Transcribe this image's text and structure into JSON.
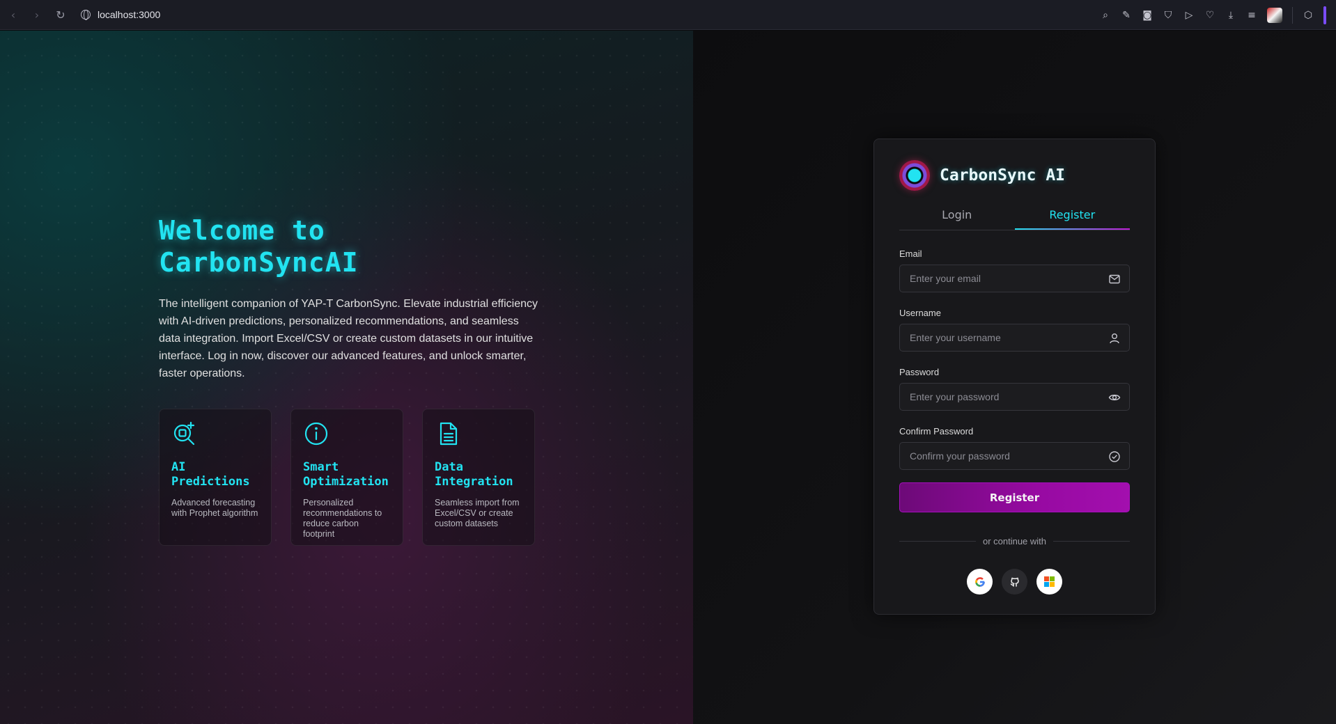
{
  "browser": {
    "url": "localhost:3000",
    "nav_icons": [
      "back-icon",
      "forward-icon",
      "reload-icon"
    ],
    "tool_icons": [
      "zoom-icon",
      "edit-icon",
      "camera-icon",
      "shield-icon",
      "send-icon",
      "heart-icon",
      "download-icon",
      "menu-icon"
    ]
  },
  "hero": {
    "title_line1": "Welcome to",
    "title_line2": "CarbonSyncAI",
    "description": "The intelligent companion of YAP-T CarbonSync. Elevate industrial efficiency with AI-driven predictions, personalized recommendations, and seamless data integration. Import Excel/CSV or create custom datasets in our intuitive interface. Log in now, discover our advanced features, and unlock smarter, faster operations.",
    "features": [
      {
        "icon": "ai-prediction-icon",
        "title_line1": "AI",
        "title_line2": "Predictions",
        "desc": "Advanced forecasting with Prophet algorithm"
      },
      {
        "icon": "info-icon",
        "title_line1": "Smart",
        "title_line2": "Optimization",
        "desc": "Personalized recommendations to reduce carbon footprint"
      },
      {
        "icon": "document-icon",
        "title_line1": "Data",
        "title_line2": "Integration",
        "desc": "Seamless import from Excel/CSV or create custom datasets"
      }
    ]
  },
  "auth": {
    "brand": "CarbonSync AI",
    "tabs": [
      "Login",
      "Register"
    ],
    "active_tab": "Register",
    "fields": {
      "email": {
        "label": "Email",
        "placeholder": "Enter your email",
        "value": ""
      },
      "username": {
        "label": "Username",
        "placeholder": "Enter your username",
        "value": ""
      },
      "password": {
        "label": "Password",
        "placeholder": "Enter your password",
        "value": ""
      },
      "confirm": {
        "label": "Confirm Password",
        "placeholder": "Confirm your password",
        "value": ""
      }
    },
    "register_label": "Register",
    "divider_text": "or continue with",
    "socials": [
      "google-icon",
      "github-icon",
      "microsoft-icon"
    ]
  },
  "colors": {
    "accent": "#22e3f1",
    "button": "#970aa2",
    "card_bg": "#18181b"
  }
}
